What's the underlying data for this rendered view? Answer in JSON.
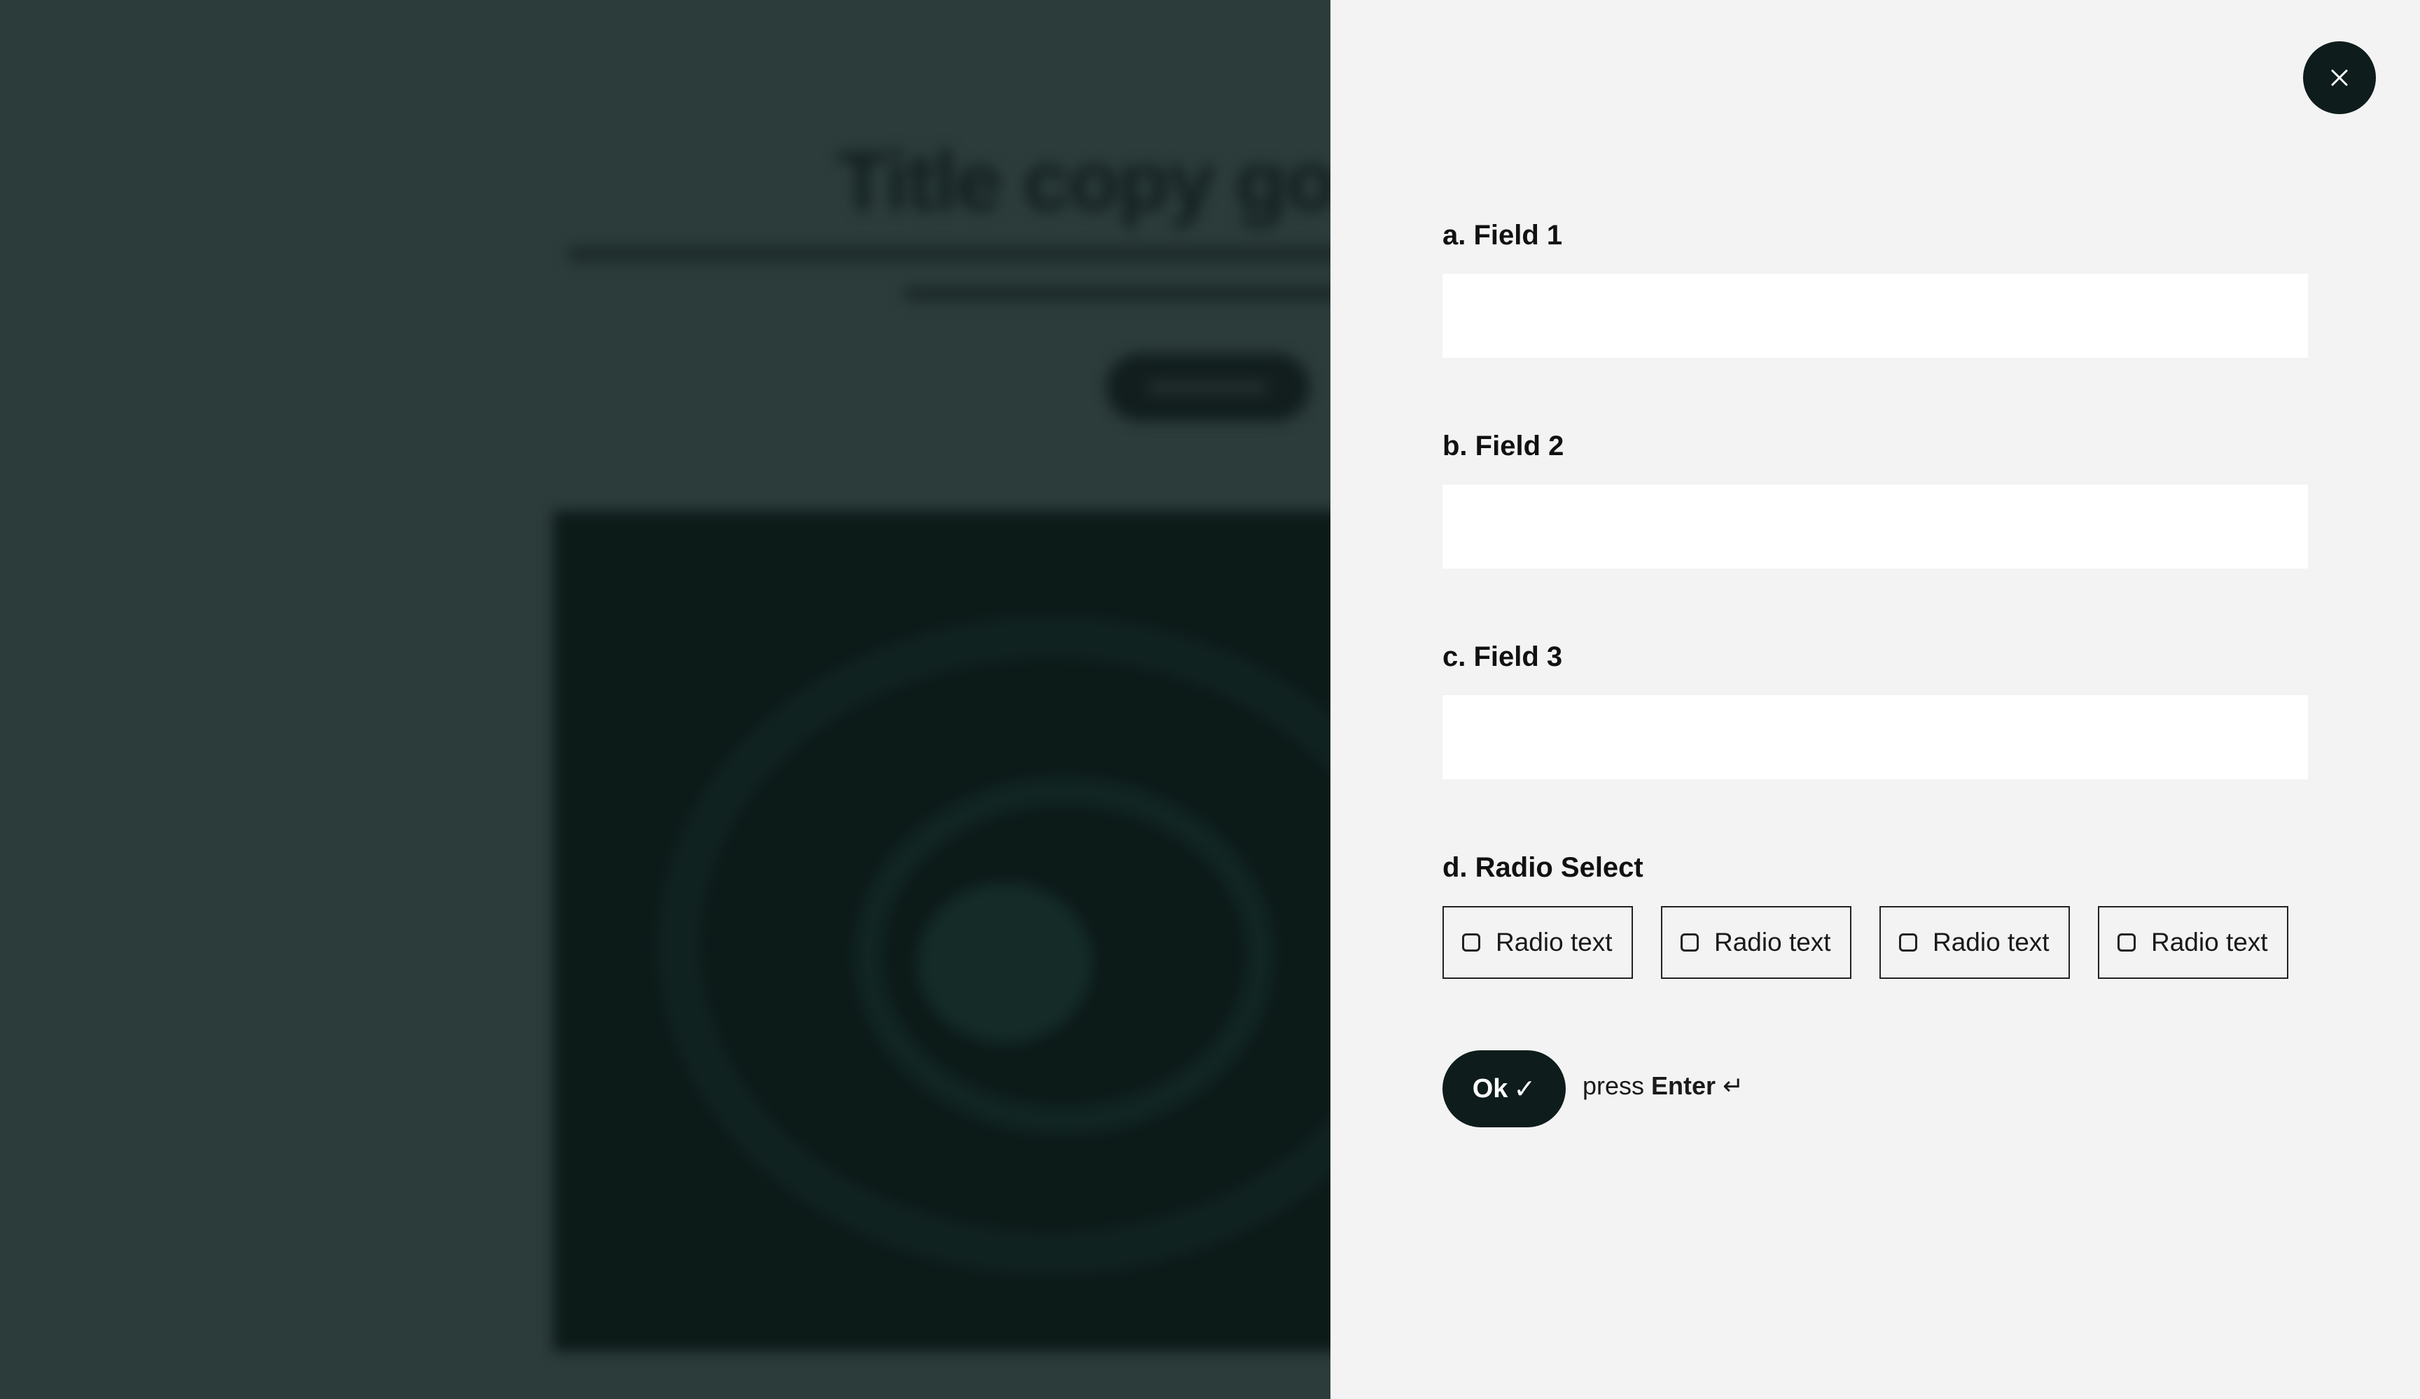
{
  "background": {
    "title": "Title copy go"
  },
  "close_button": {
    "icon": "close-icon"
  },
  "form": {
    "fields": [
      {
        "label": "a. Field 1",
        "value": "",
        "placeholder": ""
      },
      {
        "label": "b. Field 2",
        "value": "",
        "placeholder": ""
      },
      {
        "label": "c. Field 3",
        "value": "",
        "placeholder": ""
      }
    ],
    "radio": {
      "label": "d. Radio Select",
      "options": [
        {
          "label": "Radio text",
          "checked": false
        },
        {
          "label": "Radio text",
          "checked": false
        },
        {
          "label": "Radio text",
          "checked": false
        },
        {
          "label": "Radio text",
          "checked": false
        }
      ]
    },
    "submit": {
      "label": "Ok",
      "check_glyph": "✓",
      "hint_prefix": "press",
      "hint_key": "Enter",
      "hint_icon": "↵"
    }
  },
  "colors": {
    "overlay_bg": "#2c3c3b",
    "panel_bg": "#f3f3f3",
    "dark_accent": "#0e1c1b"
  }
}
